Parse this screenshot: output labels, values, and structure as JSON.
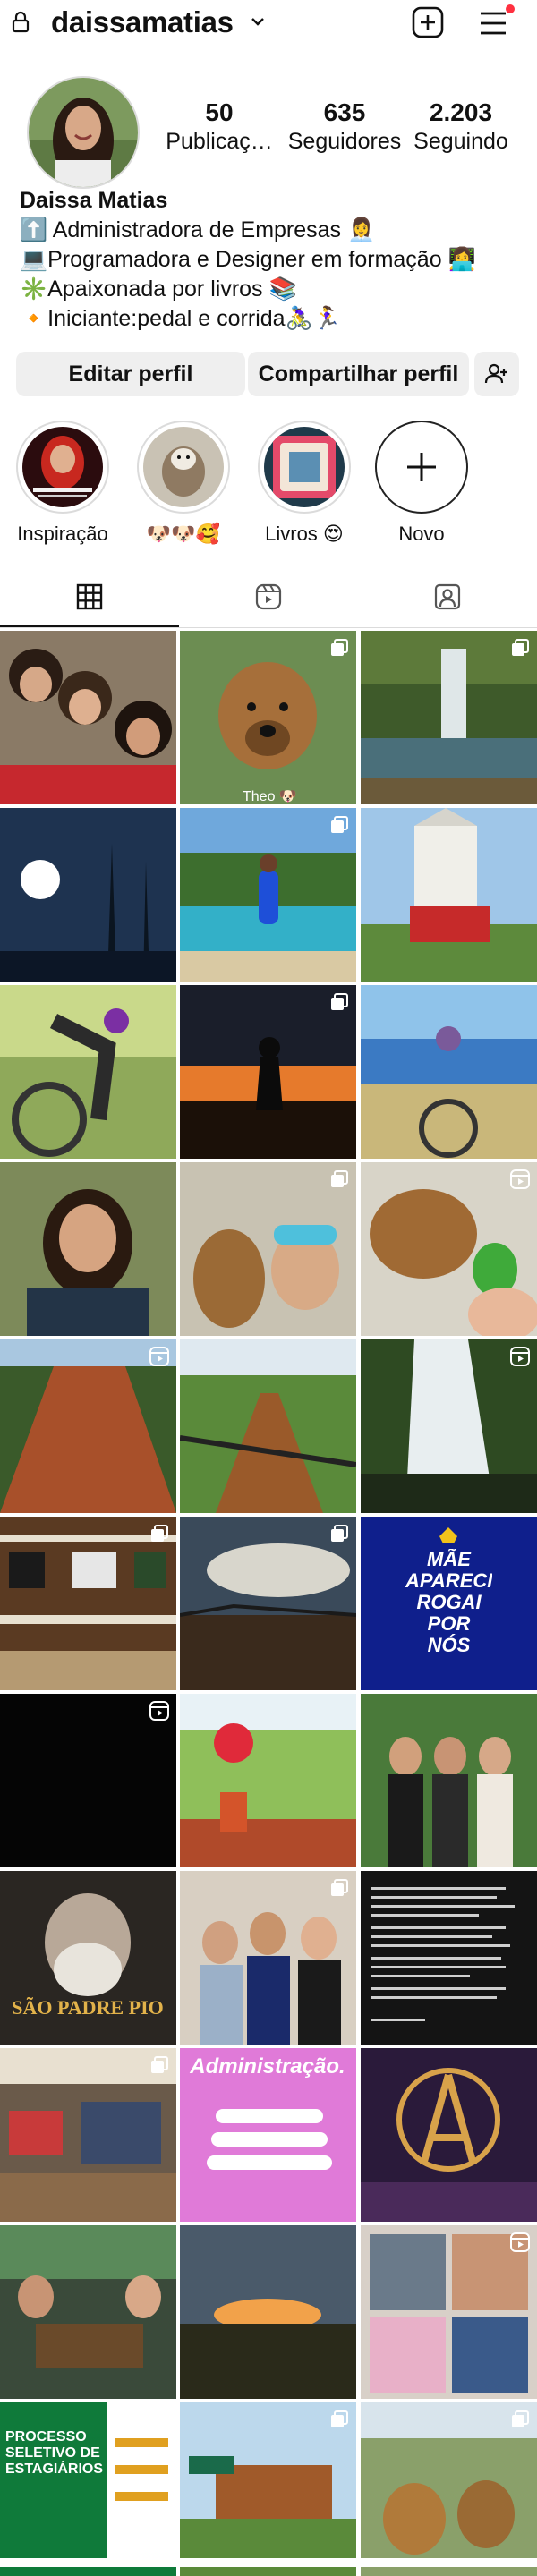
{
  "header": {
    "username": "daissamatias"
  },
  "profile": {
    "stats": [
      {
        "value": "50",
        "label": "Publicaç…"
      },
      {
        "value": "635",
        "label": "Seguidores"
      },
      {
        "value": "2.203",
        "label": "Seguindo"
      }
    ],
    "name": "Daissa Matias",
    "bio_lines": [
      "⬆️ Administradora de Empresas 👩‍💼",
      "💻Programadora e Designer em formação 👩‍💻",
      "✳️Apaixonada por livros 📚",
      "🔸Iniciante:pedal e corrida🚴‍♀️🏃‍♀️"
    ]
  },
  "actions": {
    "edit_label": "Editar perfil",
    "share_label": "Compartilhar perfil"
  },
  "highlights": [
    {
      "label": "Inspiração"
    },
    {
      "label": "🐶🐶🥰"
    },
    {
      "label": "Livros 😍"
    },
    {
      "label": "Novo"
    }
  ],
  "colors": {
    "notification_dot": "#ff3040",
    "button_bg": "#efefef",
    "divider": "#dbdbdb"
  },
  "grid_posts": [
    {
      "desc": "group-selfie-women",
      "badge": "none"
    },
    {
      "desc": "dog-portrait",
      "badge": "carousel",
      "overlay_text": "Theo 🐶"
    },
    {
      "desc": "waterfall-lake",
      "badge": "carousel"
    },
    {
      "desc": "sun-through-palms",
      "badge": "none"
    },
    {
      "desc": "woman-by-pool",
      "badge": "carousel"
    },
    {
      "desc": "cyclists-at-church",
      "badge": "none"
    },
    {
      "desc": "cyclist-with-bike",
      "badge": "none"
    },
    {
      "desc": "sunset-silhouette",
      "badge": "carousel"
    },
    {
      "desc": "cyclist-by-lake",
      "badge": "none"
    },
    {
      "desc": "selfie-in-field",
      "badge": "none"
    },
    {
      "desc": "dogs-selfie",
      "badge": "carousel"
    },
    {
      "desc": "dog-with-plant",
      "badge": "reel"
    },
    {
      "desc": "red-dirt-road",
      "badge": "reel"
    },
    {
      "desc": "bike-trail",
      "badge": "none"
    },
    {
      "desc": "big-waterfall",
      "badge": "reel"
    },
    {
      "desc": "shop-shelves",
      "badge": "carousel"
    },
    {
      "desc": "cloudy-sky-road",
      "badge": "carousel"
    },
    {
      "desc": "blue-quote-card",
      "badge": "none",
      "overlay_text": "MÃE APARECIDA ROGAI POR NÓS"
    },
    {
      "desc": "dark-video",
      "badge": "reel"
    },
    {
      "desc": "flowers-in-vase",
      "badge": "none"
    },
    {
      "desc": "three-women-party",
      "badge": "none"
    },
    {
      "desc": "padre-pio-card",
      "badge": "none",
      "overlay_text": "SÃO PADRE PIO"
    },
    {
      "desc": "graduation-photo",
      "badge": "carousel"
    },
    {
      "desc": "dark-text-post",
      "badge": "none"
    },
    {
      "desc": "shop-interior",
      "badge": "carousel"
    },
    {
      "desc": "administracao-card",
      "badge": "none",
      "overlay_text": "Administração."
    },
    {
      "desc": "avengers-logo",
      "badge": "none"
    },
    {
      "desc": "restaurant-table",
      "badge": "none"
    },
    {
      "desc": "sunset-field",
      "badge": "none"
    },
    {
      "desc": "friends-collage",
      "badge": "reel"
    },
    {
      "desc": "processo-seletivo-card",
      "badge": "none",
      "overlay_text": "PROCESSO SELETIVO DE ESTAGIÁRIOS"
    },
    {
      "desc": "building-with-sign",
      "badge": "carousel"
    },
    {
      "desc": "dogs-on-grass",
      "badge": "carousel"
    }
  ]
}
